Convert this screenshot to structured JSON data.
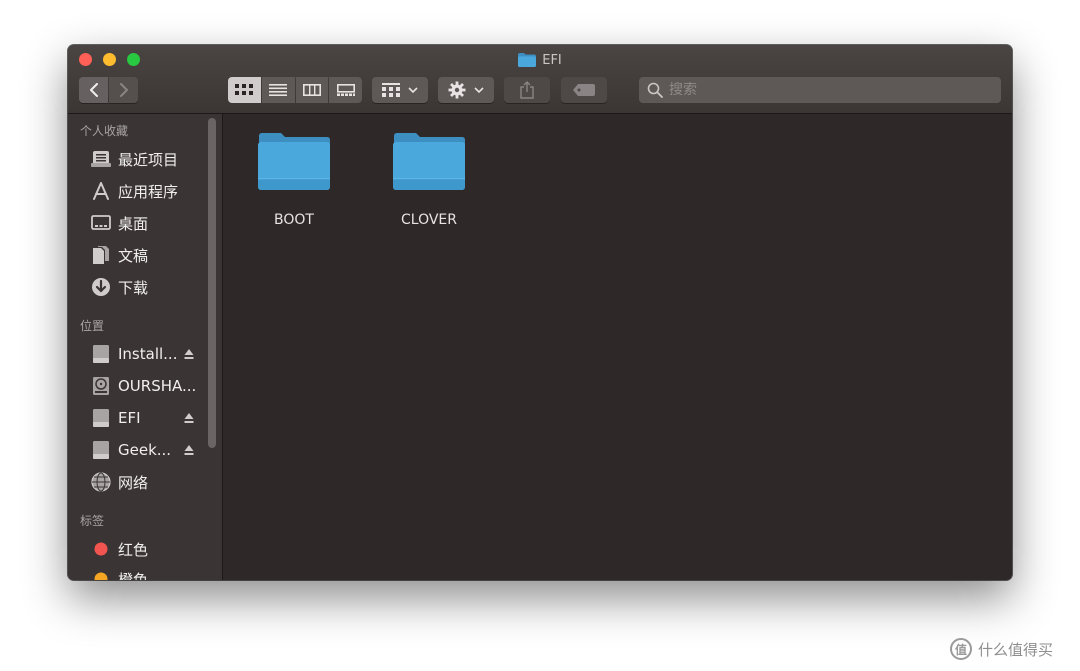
{
  "window": {
    "title": "EFI"
  },
  "toolbar": {
    "search_placeholder": "搜索"
  },
  "sidebar": {
    "sections": [
      {
        "header": "个人收藏",
        "items": [
          {
            "label": "最近项目",
            "icon": "recents-icon"
          },
          {
            "label": "应用程序",
            "icon": "applications-icon"
          },
          {
            "label": "桌面",
            "icon": "desktop-icon"
          },
          {
            "label": "文稿",
            "icon": "documents-icon"
          },
          {
            "label": "下载",
            "icon": "downloads-icon"
          }
        ]
      },
      {
        "header": "位置",
        "items": [
          {
            "label": "Install...",
            "icon": "drive-icon",
            "eject": true
          },
          {
            "label": "OURSHA...",
            "icon": "internal-disk-icon",
            "eject": false
          },
          {
            "label": "EFI",
            "icon": "drive-icon",
            "eject": true
          },
          {
            "label": "Geek...",
            "icon": "drive-icon",
            "eject": true
          },
          {
            "label": "网络",
            "icon": "network-icon",
            "eject": false
          }
        ]
      },
      {
        "header": "标签",
        "items": [
          {
            "label": "红色",
            "icon": "tag-dot-icon",
            "color": "#f2544f"
          },
          {
            "label": "橙色",
            "icon": "tag-dot-icon",
            "color": "#f5a623"
          }
        ]
      }
    ]
  },
  "content": {
    "items": [
      {
        "name": "BOOT",
        "icon": "folder-icon"
      },
      {
        "name": "CLOVER",
        "icon": "folder-icon"
      }
    ]
  },
  "watermark": {
    "logo_text": "值",
    "text": "什么值得买"
  },
  "colors": {
    "folder_blue": "#4aa8dd",
    "folder_tab": "#3d8fc2",
    "window_bg": "#2e2928",
    "sidebar_bg": "#3a3534"
  }
}
